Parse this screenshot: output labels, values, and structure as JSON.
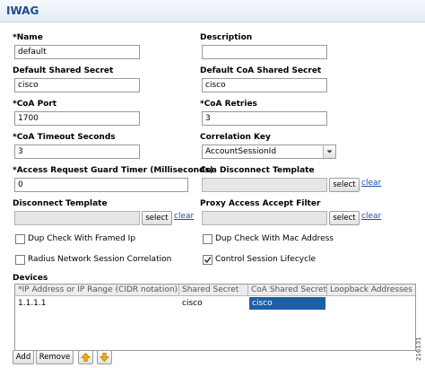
{
  "header": {
    "title": "IWAG"
  },
  "fields": {
    "name": {
      "label": "*Name",
      "value": "default"
    },
    "description": {
      "label": "Description",
      "value": ""
    },
    "default_shared_secret": {
      "label": "Default Shared Secret",
      "value": "cisco"
    },
    "default_coa_shared_secret": {
      "label": "Default CoA Shared Secret",
      "value": "cisco"
    },
    "coa_port": {
      "label": "*CoA Port",
      "value": "1700"
    },
    "coa_retries": {
      "label": "*CoA Retries",
      "value": "3"
    },
    "coa_timeout": {
      "label": "*CoA Timeout Seconds",
      "value": "3"
    },
    "correlation_key": {
      "label": "Correlation Key",
      "value": "AccountSessionId"
    },
    "access_request_guard_timer": {
      "label": "*Access Request Guard Timer (Milliseconds)",
      "value": "0"
    },
    "coa_disconnect_template": {
      "label": "Coa Disconnect Template",
      "value": ""
    },
    "disconnect_template": {
      "label": "Disconnect Template",
      "value": ""
    },
    "proxy_access_accept_filter": {
      "label": "Proxy Access Accept Filter",
      "value": ""
    }
  },
  "buttons": {
    "select": "select",
    "clear": "clear"
  },
  "checkboxes": {
    "dup_check_framed_ip": {
      "label": "Dup Check With Framed Ip",
      "checked": false
    },
    "dup_check_mac": {
      "label": "Dup Check With Mac Address",
      "checked": false
    },
    "radius_network_session_correlation": {
      "label": "Radius Network Session Correlation",
      "checked": false
    },
    "control_session_lifecycle": {
      "label": "Control Session Lifecycle",
      "checked": true
    }
  },
  "devices": {
    "label": "Devices",
    "columns": [
      "*IP Address or IP Range (CIDR notation)",
      "Shared Secret",
      "CoA Shared Secret",
      "Loopback Addresses"
    ],
    "rows": [
      [
        "1.1.1.1",
        "cisco",
        "cisco",
        ""
      ]
    ],
    "add_label": "Add",
    "remove_label": "Remove"
  },
  "icons": {
    "up": "arrow-up-icon",
    "down": "arrow-down-icon"
  },
  "colors": {
    "link": "#1c4bb4",
    "title": "#1a4f8a",
    "selected_cell": "#1f5fa6",
    "arrow_icon": "#d59b00"
  },
  "figure_id": "216131"
}
